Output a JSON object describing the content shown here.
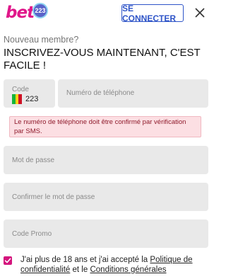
{
  "header": {
    "logo_text": "bet",
    "logo_badge": "223",
    "login_label": "SE CONNECTER",
    "close_icon": "close-icon",
    "brand_color": "#e0178a",
    "login_color": "#2f55c8"
  },
  "form": {
    "subtitle": "Nouveau membre?",
    "title": "INSCRIVEZ-VOUS MAINTENANT, C'EST FACILE !",
    "country_code": {
      "label": "Code",
      "flag_icon": "mali-flag-icon",
      "value": "223"
    },
    "phone": {
      "placeholder": "Numéro de téléphone"
    },
    "alert_text": "Le numéro de téléphone doit être confirmé par vérification par SMS.",
    "password": {
      "placeholder": "Mot de passe"
    },
    "confirm_password": {
      "placeholder": "Confirmer le mot de passe"
    },
    "promo_code": {
      "placeholder": "Code Promo"
    },
    "terms": {
      "checked": true,
      "text_before": "J'ai plus de 18 ans et j'ai accepté la ",
      "privacy_link": "Politique de confidentialité",
      "text_middle": " et le ",
      "conditions_link": "Conditions générales",
      "checkbox_color": "#d4157d"
    }
  }
}
